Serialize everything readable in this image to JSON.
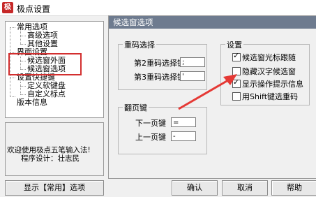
{
  "window": {
    "title": "极点设置",
    "icon_text": "极"
  },
  "tree": {
    "items": [
      {
        "label": "常用选项"
      },
      {
        "label": "高级选项"
      },
      {
        "label": "其他设置"
      },
      {
        "label": "界面设置"
      },
      {
        "label": "候选窗外面"
      },
      {
        "label": "候选窗选项"
      },
      {
        "label": "设置快捷键"
      },
      {
        "label": "定义软键盘"
      },
      {
        "label": "自定义标点"
      },
      {
        "label": "版本信息"
      }
    ]
  },
  "welcome": {
    "line1": "欢迎使用极点五笔输入法!",
    "line2": "程序设计：壮志民"
  },
  "buttons": {
    "show_common": "显示【常用】选项",
    "ok": "确认",
    "cancel": "取消",
    "help": "帮助"
  },
  "panel": {
    "title": "候选窗选项",
    "reselect_group": {
      "label": "重码选择",
      "second_label": "第2重码选择键",
      "second_value": ";",
      "third_label": "第3重码选择键",
      "third_value": "'"
    },
    "paging_group": {
      "label": "翻页键",
      "next_label": "下一页键",
      "next_value": "=",
      "prev_label": "上一页键",
      "prev_value": "-"
    },
    "settings_group": {
      "label": "设置",
      "options": [
        {
          "label": "候选窗光标跟随",
          "checked": true
        },
        {
          "label": "隐藏汉字候选窗",
          "checked": false
        },
        {
          "label": "显示操作提示信息",
          "checked": true
        },
        {
          "label": "用Shift键选重码",
          "checked": false
        }
      ]
    }
  },
  "colors": {
    "panel_header_bg": "#6e7b8f",
    "highlight_border": "#d32f2f",
    "arrow": "#e53935"
  }
}
